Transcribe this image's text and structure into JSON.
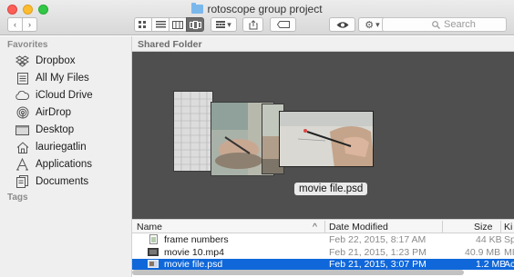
{
  "window": {
    "title": "rotoscope group project"
  },
  "toolbar": {
    "back_glyph": "‹",
    "forward_glyph": "›",
    "view_icons": [
      "icon-view-icon",
      "list-view-icon",
      "column-view-icon",
      "coverflow-view-icon"
    ],
    "arrange_glyph": "▾",
    "action_glyph": "▾",
    "search_placeholder": "Search"
  },
  "sidebar": {
    "favorites_label": "Favorites",
    "tags_label": "Tags",
    "items": [
      {
        "label": "Dropbox",
        "icon": "dropbox-icon"
      },
      {
        "label": "All My Files",
        "icon": "all-files-icon"
      },
      {
        "label": "iCloud Drive",
        "icon": "cloud-icon"
      },
      {
        "label": "AirDrop",
        "icon": "airdrop-icon"
      },
      {
        "label": "Desktop",
        "icon": "desktop-icon"
      },
      {
        "label": "lauriegatlin",
        "icon": "home-icon"
      },
      {
        "label": "Applications",
        "icon": "applications-icon"
      },
      {
        "label": "Documents",
        "icon": "documents-icon"
      }
    ]
  },
  "main": {
    "path_title": "Shared Folder",
    "coverflow_label": "movie file.psd",
    "columns": {
      "name": "Name",
      "sort_glyph": "^",
      "date": "Date Modified",
      "size": "Size",
      "kind": "Ki"
    },
    "files": [
      {
        "name": "frame numbers",
        "date": "Feb 22, 2015, 8:17 AM",
        "size": "44 KB",
        "kind": "Sp",
        "icon": "spreadsheet-file-icon",
        "selected": false
      },
      {
        "name": "movie 10.mp4",
        "date": "Feb 21, 2015, 1:23 PM",
        "size": "40.9 MB",
        "kind": "MI",
        "icon": "movie-file-icon",
        "selected": false
      },
      {
        "name": "movie file.psd",
        "date": "Feb 21, 2015, 3:07 PM",
        "size": "1.2 MB",
        "kind": "Ac",
        "icon": "psd-file-icon",
        "selected": true
      }
    ]
  },
  "colors": {
    "selection": "#0f67da",
    "preview_bg": "#4f4f4f",
    "sidebar_bg": "#f0eff0"
  }
}
